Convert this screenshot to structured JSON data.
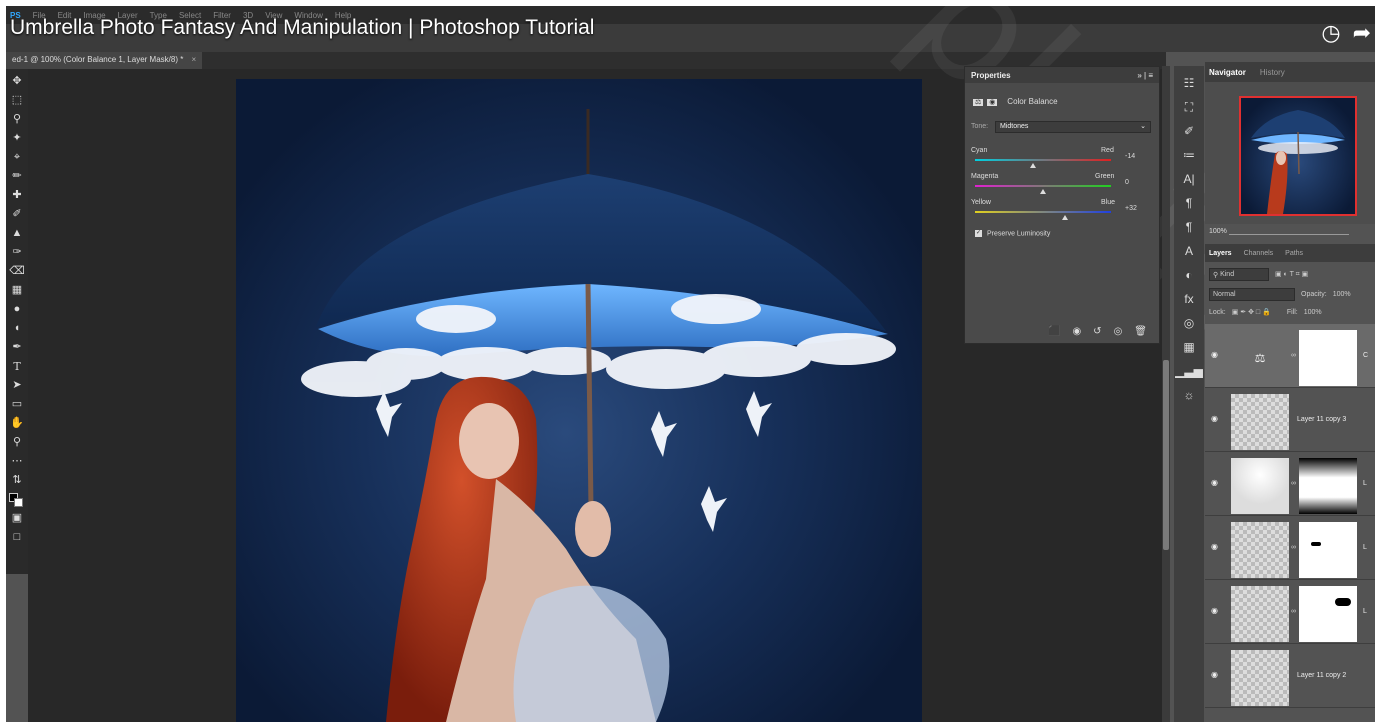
{
  "menu": {
    "app_badge": "PS",
    "items": [
      "File",
      "Edit",
      "Image",
      "Layer",
      "Type",
      "Select",
      "Filter",
      "3D",
      "View",
      "Window",
      "Help"
    ]
  },
  "video": {
    "title": "Umbrella Photo Fantasy And Manipulation | Photoshop Tutorial",
    "watch_later_icon": "clock-icon",
    "share_icon": "share-arrow-icon"
  },
  "document_tab": {
    "label": "ed-1 @ 100% (Color Balance 1, Layer Mask/8) *",
    "close": "×"
  },
  "tools": [
    "move",
    "marquee",
    "lasso",
    "magic-wand",
    "crop",
    "eyedropper",
    "spot-heal",
    "brush",
    "stamp",
    "history-brush",
    "eraser",
    "gradient",
    "blur",
    "dodge",
    "pen",
    "type",
    "path-select",
    "rectangle",
    "hand",
    "zoom",
    "more",
    "swap-colors",
    "fg-bg-colors",
    "quick-mask",
    "screen-mode"
  ],
  "properties": {
    "tab": "Properties",
    "adjustment": "Color Balance",
    "tone_label": "Tone:",
    "tone_value": "Midtones",
    "sliders": [
      {
        "left": "Cyan",
        "right": "Red",
        "value": "-14",
        "level": -14
      },
      {
        "left": "Magenta",
        "right": "Green",
        "value": "0",
        "level": 0
      },
      {
        "left": "Yellow",
        "right": "Blue",
        "value": "+32",
        "level": 32
      }
    ],
    "preserve_luminosity": "Preserve Luminosity",
    "preserve_checked": true
  },
  "navigator": {
    "tabs": [
      "Navigator",
      "History"
    ],
    "zoom": "100%"
  },
  "layers_panel": {
    "tabs": [
      "Layers",
      "Channels",
      "Paths"
    ],
    "filter": "Kind",
    "blend_mode": "Normal",
    "opacity_label": "Opacity:",
    "opacity": "100%",
    "lock_label": "Lock:",
    "fill_label": "Fill:",
    "fill": "100%",
    "layers": [
      {
        "name": "C",
        "type": "adjustment",
        "selected": true
      },
      {
        "name": "Layer 11 copy 3",
        "type": "pixel"
      },
      {
        "name": "L",
        "type": "masked"
      },
      {
        "name": "L",
        "type": "masked"
      },
      {
        "name": "L",
        "type": "masked"
      },
      {
        "name": "Layer 11 copy 2",
        "type": "pixel"
      }
    ]
  },
  "colors": {
    "accent_blue": "#31a8ff",
    "navigator_frame": "#e03030"
  }
}
